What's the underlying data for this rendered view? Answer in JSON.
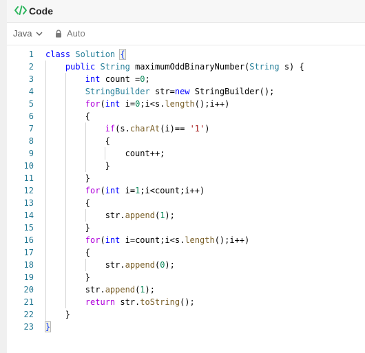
{
  "header": {
    "title": "Code",
    "icon": "code-icon"
  },
  "toolbar": {
    "language": "Java",
    "mode": "Auto"
  },
  "editor": {
    "lines": [
      {
        "n": "1",
        "tokens": [
          {
            "t": "class ",
            "c": "#0000ff"
          },
          {
            "t": "Solution ",
            "c": "#267f99"
          },
          {
            "t": "{",
            "c": "#0431fa"
          }
        ]
      },
      {
        "n": "2",
        "tokens": [
          {
            "t": "    public ",
            "c": "#0000ff"
          },
          {
            "t": "String ",
            "c": "#267f99"
          },
          {
            "t": "maximumOddBinaryNumber(",
            "c": "#000000"
          },
          {
            "t": "String ",
            "c": "#267f99"
          },
          {
            "t": "s) {",
            "c": "#000000"
          }
        ]
      },
      {
        "n": "3",
        "tokens": [
          {
            "t": "        int ",
            "c": "#0000ff"
          },
          {
            "t": "count =",
            "c": "#000000"
          },
          {
            "t": "0",
            "c": "#098658"
          },
          {
            "t": ";",
            "c": "#000000"
          }
        ]
      },
      {
        "n": "4",
        "tokens": [
          {
            "t": "        StringBuilder ",
            "c": "#267f99"
          },
          {
            "t": "str=",
            "c": "#000000"
          },
          {
            "t": "new ",
            "c": "#0000ff"
          },
          {
            "t": "StringBuilder();",
            "c": "#000000"
          }
        ]
      },
      {
        "n": "5",
        "tokens": [
          {
            "t": "        for",
            "c": "#af00db"
          },
          {
            "t": "(",
            "c": "#000000"
          },
          {
            "t": "int ",
            "c": "#0000ff"
          },
          {
            "t": "i=",
            "c": "#000000"
          },
          {
            "t": "0",
            "c": "#098658"
          },
          {
            "t": ";i<s.",
            "c": "#000000"
          },
          {
            "t": "length",
            "c": "#795e26"
          },
          {
            "t": "();i++)",
            "c": "#000000"
          }
        ]
      },
      {
        "n": "6",
        "tokens": [
          {
            "t": "        {",
            "c": "#000000"
          }
        ]
      },
      {
        "n": "7",
        "tokens": [
          {
            "t": "            if",
            "c": "#af00db"
          },
          {
            "t": "(s.",
            "c": "#000000"
          },
          {
            "t": "charAt",
            "c": "#795e26"
          },
          {
            "t": "(i)== ",
            "c": "#000000"
          },
          {
            "t": "'1'",
            "c": "#a31515"
          },
          {
            "t": ")",
            "c": "#000000"
          }
        ]
      },
      {
        "n": "8",
        "tokens": [
          {
            "t": "            {",
            "c": "#000000"
          }
        ]
      },
      {
        "n": "9",
        "tokens": [
          {
            "t": "                count++;",
            "c": "#000000"
          }
        ]
      },
      {
        "n": "10",
        "tokens": [
          {
            "t": "            }",
            "c": "#000000"
          }
        ]
      },
      {
        "n": "11",
        "tokens": [
          {
            "t": "        }",
            "c": "#000000"
          }
        ]
      },
      {
        "n": "12",
        "tokens": [
          {
            "t": "        for",
            "c": "#af00db"
          },
          {
            "t": "(",
            "c": "#000000"
          },
          {
            "t": "int ",
            "c": "#0000ff"
          },
          {
            "t": "i=",
            "c": "#000000"
          },
          {
            "t": "1",
            "c": "#098658"
          },
          {
            "t": ";i<count;i++)",
            "c": "#000000"
          }
        ]
      },
      {
        "n": "13",
        "tokens": [
          {
            "t": "        {",
            "c": "#000000"
          }
        ]
      },
      {
        "n": "14",
        "tokens": [
          {
            "t": "            str.",
            "c": "#000000"
          },
          {
            "t": "append",
            "c": "#795e26"
          },
          {
            "t": "(",
            "c": "#000000"
          },
          {
            "t": "1",
            "c": "#098658"
          },
          {
            "t": ");",
            "c": "#000000"
          }
        ]
      },
      {
        "n": "15",
        "tokens": [
          {
            "t": "        }",
            "c": "#000000"
          }
        ]
      },
      {
        "n": "16",
        "tokens": [
          {
            "t": "        for",
            "c": "#af00db"
          },
          {
            "t": "(",
            "c": "#000000"
          },
          {
            "t": "int ",
            "c": "#0000ff"
          },
          {
            "t": "i=count;i<s.",
            "c": "#000000"
          },
          {
            "t": "length",
            "c": "#795e26"
          },
          {
            "t": "();i++)",
            "c": "#000000"
          }
        ]
      },
      {
        "n": "17",
        "tokens": [
          {
            "t": "        {",
            "c": "#000000"
          }
        ]
      },
      {
        "n": "18",
        "tokens": [
          {
            "t": "            str.",
            "c": "#000000"
          },
          {
            "t": "append",
            "c": "#795e26"
          },
          {
            "t": "(",
            "c": "#000000"
          },
          {
            "t": "0",
            "c": "#098658"
          },
          {
            "t": ");",
            "c": "#000000"
          }
        ]
      },
      {
        "n": "19",
        "tokens": [
          {
            "t": "        }",
            "c": "#000000"
          }
        ]
      },
      {
        "n": "20",
        "tokens": [
          {
            "t": "        str.",
            "c": "#000000"
          },
          {
            "t": "append",
            "c": "#795e26"
          },
          {
            "t": "(",
            "c": "#000000"
          },
          {
            "t": "1",
            "c": "#098658"
          },
          {
            "t": ");",
            "c": "#000000"
          }
        ]
      },
      {
        "n": "21",
        "tokens": [
          {
            "t": "        return ",
            "c": "#af00db"
          },
          {
            "t": "str.",
            "c": "#000000"
          },
          {
            "t": "toString",
            "c": "#795e26"
          },
          {
            "t": "();",
            "c": "#000000"
          }
        ]
      },
      {
        "n": "22",
        "tokens": [
          {
            "t": "    }",
            "c": "#000000"
          }
        ]
      },
      {
        "n": "23",
        "tokens": [
          {
            "t": "}",
            "c": "#0431fa"
          }
        ]
      }
    ]
  },
  "colors": {
    "code_icon": "#2db55d",
    "line_number": "#237893",
    "bracket_highlight": "#b9b9b9"
  }
}
